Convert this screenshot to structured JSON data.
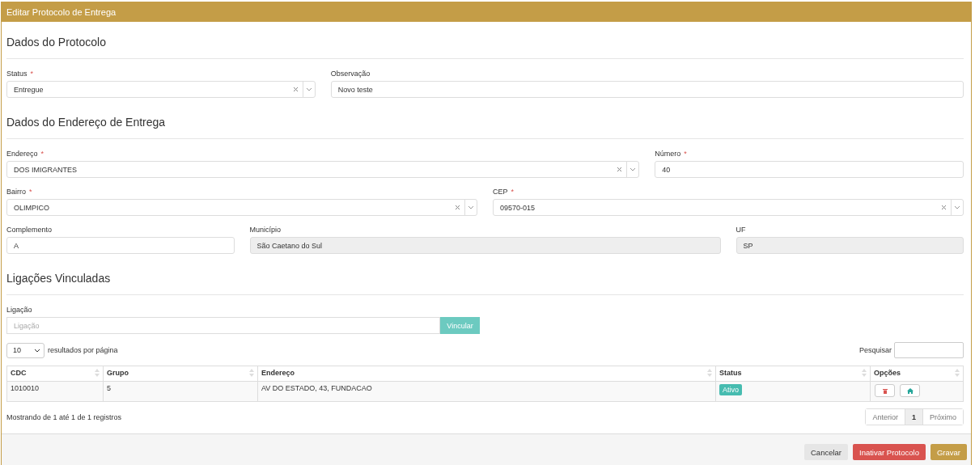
{
  "window": {
    "title": "Editar Protocolo de Entrega"
  },
  "sections": [
    {
      "title": "Dados do Protocolo",
      "rows": [
        [
          {
            "kind": "select",
            "label": "Status",
            "mark": "*",
            "value": "Entregue"
          },
          {
            "kind": "text",
            "label": "Observação",
            "value": "Novo teste"
          }
        ]
      ]
    },
    {
      "title": "Dados do Endereço de Entrega",
      "rows": [
        [
          {
            "kind": "select",
            "label": "Endereço",
            "mark": "*",
            "value": "DOS IMIGRANTES"
          },
          {
            "kind": "text",
            "label": "Número",
            "mark": "*",
            "value": "40"
          }
        ],
        [
          {
            "kind": "select",
            "label": "Bairro",
            "mark": "*",
            "value": "OLIMPICO"
          },
          {
            "kind": "select",
            "label": "CEP",
            "mark": "*",
            "value": "09570-015"
          }
        ],
        [
          {
            "kind": "text",
            "label": "Complemento",
            "value": "A"
          },
          {
            "kind": "readonly",
            "label": "Município",
            "value": "São Caetano do Sul"
          },
          {
            "kind": "readonly",
            "label": "UF",
            "value": "SP"
          }
        ]
      ]
    }
  ],
  "links": {
    "title": "Ligações Vinculadas",
    "field_label": "Ligação",
    "placeholder": "Ligação",
    "button": "Vincular",
    "page_length": "10",
    "page_length_label": "resultados por página",
    "search_label": "Pesquisar",
    "columns": [
      "CDC",
      "Grupo",
      "Endereço",
      "Status",
      "Opções"
    ],
    "rows": [
      {
        "cdc": "1010010",
        "grupo": "5",
        "endereco": "AV DO ESTADO, 43, FUNDACAO",
        "status": "Ativo"
      }
    ],
    "info": "Mostrando de 1 até 1 de 1 registros",
    "pagination": [
      {
        "label": "Anterior",
        "selected": false
      },
      {
        "label": "1",
        "selected": true
      },
      {
        "label": "Próximo",
        "selected": false
      }
    ]
  },
  "buttons": [
    {
      "label": "Cancelar",
      "kind": "default"
    },
    {
      "label": "Inativar Protocolo",
      "kind": "danger"
    },
    {
      "label": "Gravar",
      "kind": "primary"
    }
  ]
}
